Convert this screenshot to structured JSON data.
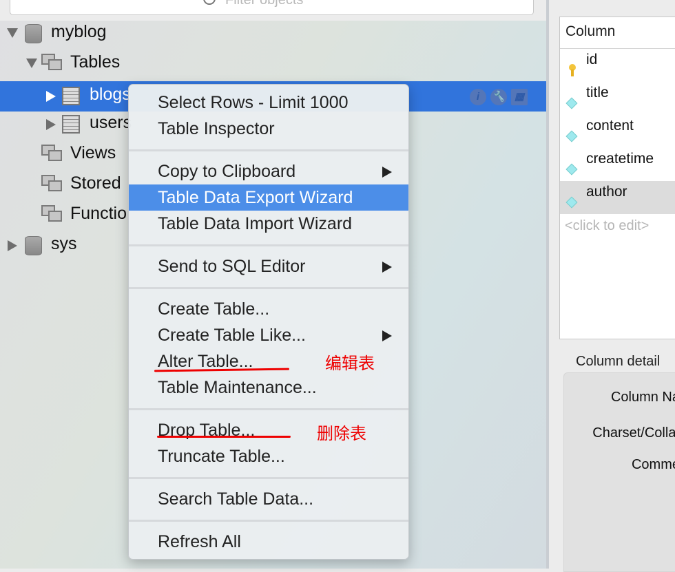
{
  "filter": {
    "placeholder": "Filter objects"
  },
  "tree": [
    {
      "label": "myblog",
      "icon": "database-icon",
      "expanded": true
    },
    {
      "label": "Tables",
      "icon": "tables-group-icon",
      "expanded": true
    },
    {
      "label": "blogs",
      "icon": "table-icon",
      "selected": true
    },
    {
      "label": "users",
      "icon": "table-icon"
    },
    {
      "label": "Views",
      "icon": "views-group-icon"
    },
    {
      "label": "Stored",
      "icon": "procedures-group-icon"
    },
    {
      "label": "Functio",
      "icon": "functions-group-icon"
    },
    {
      "label": "sys",
      "icon": "database-icon",
      "expanded": false
    }
  ],
  "row_actions": {
    "info": "i",
    "settings": "wrench",
    "edit": "table-edit"
  },
  "menu": {
    "items": [
      {
        "label": "Select Rows - Limit 1000"
      },
      {
        "label": "Table Inspector"
      },
      {
        "label": "Copy to Clipboard",
        "submenu": true
      },
      {
        "label": "Table Data Export Wizard",
        "highlighted": true
      },
      {
        "label": "Table Data Import Wizard"
      },
      {
        "label": "Send to SQL Editor",
        "submenu": true
      },
      {
        "label": "Create Table..."
      },
      {
        "label": "Create Table Like...",
        "submenu": true
      },
      {
        "label": "Alter Table..."
      },
      {
        "label": "Table Maintenance..."
      },
      {
        "label": "Drop Table..."
      },
      {
        "label": "Truncate Table..."
      },
      {
        "label": "Search Table Data..."
      },
      {
        "label": "Refresh All"
      }
    ]
  },
  "annotations": {
    "alter": "编辑表",
    "drop": "删除表",
    "color": "#e00000"
  },
  "columns": {
    "header": "Column",
    "rows": [
      "id",
      "title",
      "content",
      "createtime",
      "author"
    ],
    "placeholder": "<click to edit>"
  },
  "column_details": {
    "title": "Column detail",
    "labels": [
      "Column Na",
      "Charset/Collat",
      "Comme"
    ]
  },
  "colors": {
    "selection": "#3174dc",
    "menu_highlight": "#4c8ee8"
  }
}
